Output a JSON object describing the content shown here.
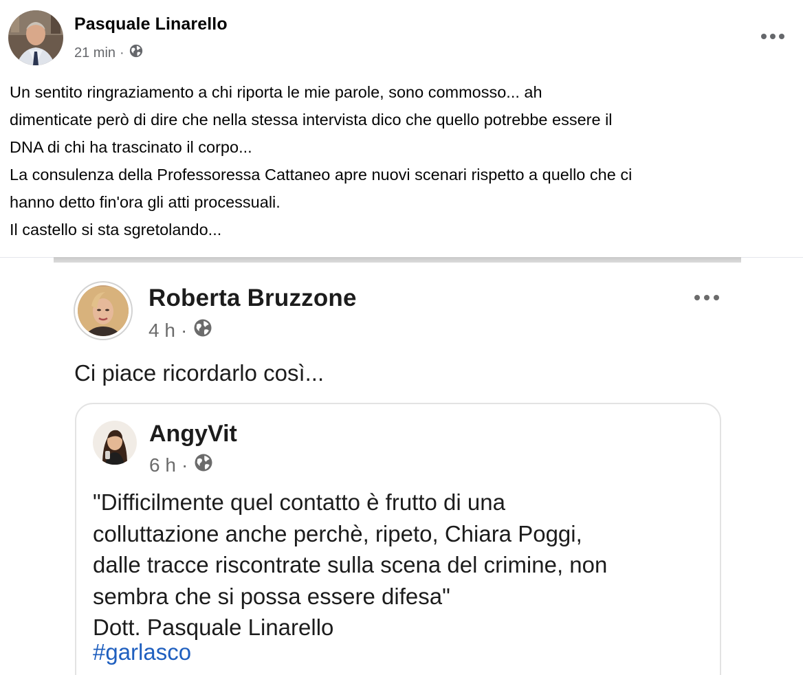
{
  "post": {
    "author": "Pasquale Linarello",
    "time": "21 min",
    "separator": "·",
    "audience_icon": "globe-icon",
    "more_icon": "more-options-icon",
    "text_lines": [
      "Un sentito ringraziamento a chi riporta le mie parole, sono commosso... ah",
      "dimenticate però di dire che nella stessa intervista dico che quello potrebbe essere il",
      "DNA di chi ha trascinato il corpo...",
      "La consulenza della Professoressa Cattaneo apre nuovi scenari rispetto a quello che ci",
      "hanno detto fin'ora gli atti processuali.",
      "Il castello si sta sgretolando..."
    ]
  },
  "shared_image": {
    "author": "Roberta Bruzzone",
    "time": "4 h",
    "separator": "·",
    "caption": "Ci piace ricordarlo così...",
    "quoted_post": {
      "author": "AngyVit",
      "time": "6 h",
      "separator": "·",
      "text_lines": [
        "\"Difficilmente quel contatto è frutto di una",
        "colluttazione anche perchè, ripeto, Chiara Poggi,",
        "dalle tracce riscontrate sulla scena del crimine, non",
        "sembra che si possa essere difesa\"",
        " Dott. Pasquale Linarello"
      ],
      "hashtag": "#garlasco"
    }
  },
  "colors": {
    "text_primary": "#050505",
    "text_secondary": "#65676b",
    "hashtag": "#1f5fbf",
    "divider": "#e4e6eb"
  }
}
